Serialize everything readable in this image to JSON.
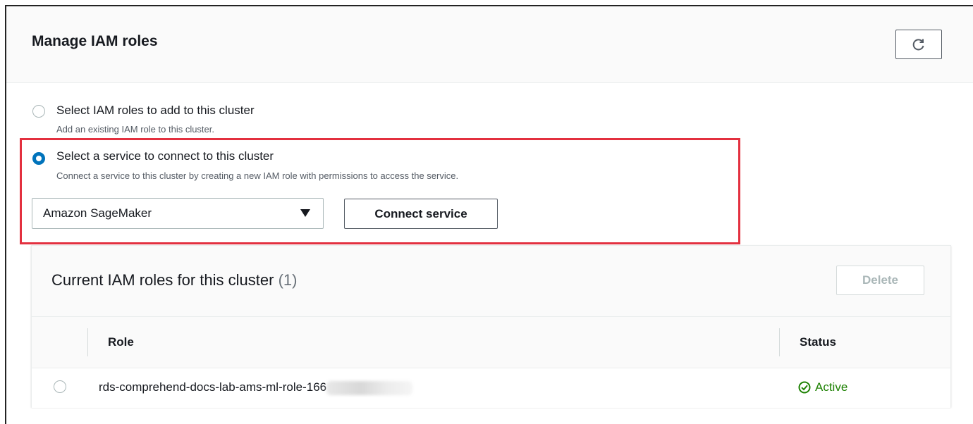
{
  "panel": {
    "title": "Manage IAM roles",
    "refresh_icon": "refresh-icon"
  },
  "options": [
    {
      "label": "Select IAM roles to add to this cluster",
      "description": "Add an existing IAM role to this cluster.",
      "selected": false
    },
    {
      "label": "Select a service to connect to this cluster",
      "description": "Connect a service to this cluster by creating a new IAM role with permissions to access the service.",
      "selected": true
    }
  ],
  "service_select": {
    "value": "Amazon SageMaker",
    "icon": "caret-down-icon"
  },
  "connect_button": {
    "label": "Connect service"
  },
  "roles_table": {
    "title": "Current IAM roles for this cluster",
    "count": "(1)",
    "delete_label": "Delete",
    "columns": [
      "Role",
      "Status"
    ],
    "rows": [
      {
        "role": "rds-comprehend-docs-lab-ams-ml-role-166",
        "role_redacted": true,
        "status": "Active",
        "status_icon": "check-circle-icon"
      }
    ]
  },
  "colors": {
    "accent": "#0073bb",
    "highlight": "#e3303f",
    "status_active": "#1d8102"
  }
}
